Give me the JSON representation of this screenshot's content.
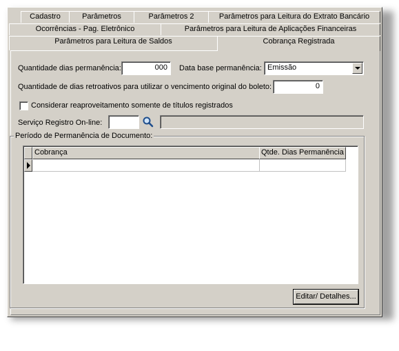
{
  "tabs_row1": [
    "Cadastro",
    "Parâmetros",
    "Parâmetros 2",
    "Parâmetros para Leitura do Extrato Bancário"
  ],
  "tabs_row2": [
    "Ocorrências - Pag. Eletrônico",
    "Parâmetros para Leitura de Aplicações Financeiras"
  ],
  "tabs_row3": [
    "Parâmetros para Leitura de Saldos",
    "Cobrança Registrada"
  ],
  "active_tab": "Cobrança Registrada",
  "form": {
    "qtd_dias_label": "Quantidade dias permanência:",
    "qtd_dias_value": "000",
    "data_base_label": "Data base permanência:",
    "data_base_value": "Emissão",
    "retroativos_label": "Quantidade de dias retroativos para utilizar o vencimento original do boleto:",
    "retroativos_value": "0",
    "checkbox_label": "Considerar reaproveitamento somente de títulos registrados",
    "checkbox_checked": false,
    "servico_label": "Serviço Registro On-line:",
    "servico_value": "",
    "servico_desc": ""
  },
  "group": {
    "title": "Período de Permanência de Documento:",
    "columns": [
      "Cobrança",
      "Qtde. Dias Permanência"
    ],
    "rows": [
      [
        "",
        ""
      ]
    ]
  },
  "edit_button": "Editar/ Detalhes..."
}
